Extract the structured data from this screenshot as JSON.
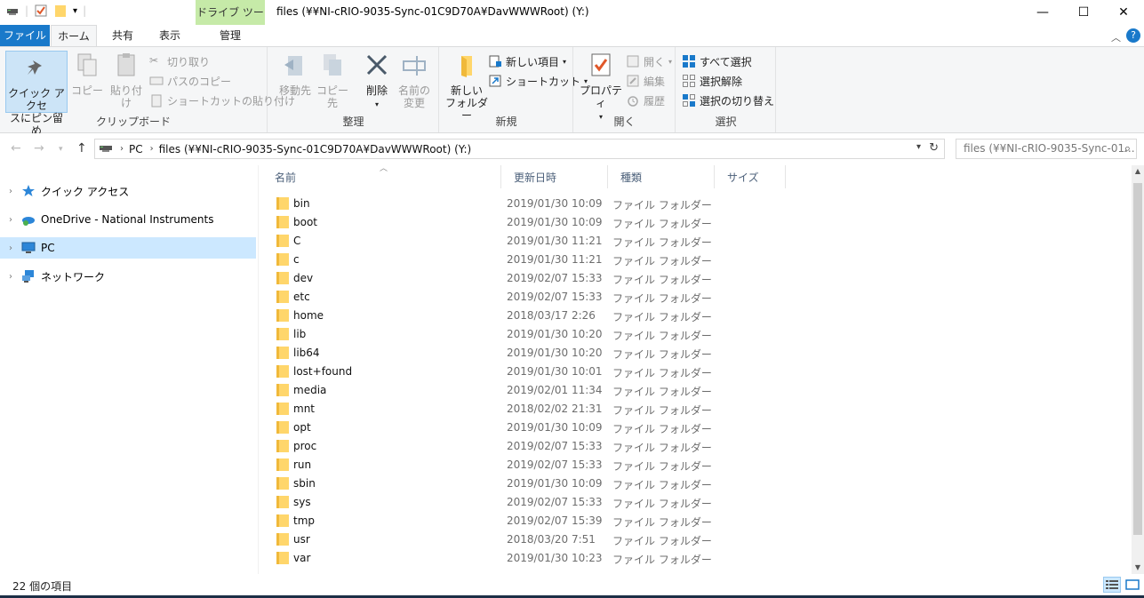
{
  "window": {
    "title": "files (¥¥NI-cRIO-9035-Sync-01C9D70A¥DavWWWRoot) (Y:)",
    "context_tab_title": "ドライブ ツール",
    "minimize_label": "—",
    "maximize_label": "☐",
    "close_label": "✕"
  },
  "ribbon_tabs": {
    "file": "ファイル",
    "home": "ホーム",
    "share": "共有",
    "view": "表示",
    "manage": "管理",
    "help": "?"
  },
  "ribbon": {
    "clipboard": {
      "label": "クリップボード",
      "pin_line1": "クイック アクセ",
      "pin_line2": "スにピン留め",
      "copy": "コピー",
      "paste": "貼り付け",
      "cut": "切り取り",
      "copy_path": "パスのコピー",
      "paste_shortcut": "ショートカットの貼り付け"
    },
    "organize": {
      "label": "整理",
      "move_to": "移動先",
      "copy_to": "コピー先",
      "delete": "削除",
      "rename_line1": "名前の",
      "rename_line2": "変更"
    },
    "new": {
      "label": "新規",
      "new_folder_line1": "新しい",
      "new_folder_line2": "フォルダー",
      "new_item": "新しい項目",
      "shortcut": "ショートカット"
    },
    "open": {
      "label": "開く",
      "properties": "プロパティ",
      "open": "開く",
      "edit": "編集",
      "history": "履歴"
    },
    "select": {
      "label": "選択",
      "select_all": "すべて選択",
      "select_none": "選択解除",
      "invert": "選択の切り替え"
    }
  },
  "address": {
    "crumbs": [
      "PC",
      "files (¥¥NI-cRIO-9035-Sync-01C9D70A¥DavWWWRoot) (Y:)"
    ],
    "search_placeholder": "files (¥¥NI-cRIO-9035-Sync-01..."
  },
  "nav_pane": {
    "items": [
      {
        "label": "クイック アクセス",
        "icon": "star-icon"
      },
      {
        "label": "OneDrive - National Instruments",
        "icon": "onedrive-icon"
      },
      {
        "label": "PC",
        "icon": "pc-icon"
      },
      {
        "label": "ネットワーク",
        "icon": "network-icon"
      }
    ]
  },
  "columns": {
    "name": "名前",
    "date": "更新日時",
    "type": "種類",
    "size": "サイズ"
  },
  "files": [
    {
      "name": "bin",
      "date": "2019/01/30 10:09",
      "type": "ファイル フォルダー"
    },
    {
      "name": "boot",
      "date": "2019/01/30 10:09",
      "type": "ファイル フォルダー"
    },
    {
      "name": "C",
      "date": "2019/01/30 11:21",
      "type": "ファイル フォルダー"
    },
    {
      "name": "c",
      "date": "2019/01/30 11:21",
      "type": "ファイル フォルダー"
    },
    {
      "name": "dev",
      "date": "2019/02/07 15:33",
      "type": "ファイル フォルダー"
    },
    {
      "name": "etc",
      "date": "2019/02/07 15:33",
      "type": "ファイル フォルダー"
    },
    {
      "name": "home",
      "date": "2018/03/17 2:26",
      "type": "ファイル フォルダー"
    },
    {
      "name": "lib",
      "date": "2019/01/30 10:20",
      "type": "ファイル フォルダー"
    },
    {
      "name": "lib64",
      "date": "2019/01/30 10:20",
      "type": "ファイル フォルダー"
    },
    {
      "name": "lost+found",
      "date": "2019/01/30 10:01",
      "type": "ファイル フォルダー"
    },
    {
      "name": "media",
      "date": "2019/02/01 11:34",
      "type": "ファイル フォルダー"
    },
    {
      "name": "mnt",
      "date": "2018/02/02 21:31",
      "type": "ファイル フォルダー"
    },
    {
      "name": "opt",
      "date": "2019/01/30 10:09",
      "type": "ファイル フォルダー"
    },
    {
      "name": "proc",
      "date": "2019/02/07 15:33",
      "type": "ファイル フォルダー"
    },
    {
      "name": "run",
      "date": "2019/02/07 15:33",
      "type": "ファイル フォルダー"
    },
    {
      "name": "sbin",
      "date": "2019/01/30 10:09",
      "type": "ファイル フォルダー"
    },
    {
      "name": "sys",
      "date": "2019/02/07 15:33",
      "type": "ファイル フォルダー"
    },
    {
      "name": "tmp",
      "date": "2019/02/07 15:39",
      "type": "ファイル フォルダー"
    },
    {
      "name": "usr",
      "date": "2018/03/20 7:51",
      "type": "ファイル フォルダー"
    },
    {
      "name": "var",
      "date": "2019/01/30 10:23",
      "type": "ファイル フォルダー"
    }
  ],
  "status": {
    "item_count": "22 個の項目"
  },
  "colors": {
    "accent": "#1979ca",
    "drive_tools": "#c6eaa8",
    "selection": "#cce8ff",
    "folder": "#ffd66b"
  }
}
